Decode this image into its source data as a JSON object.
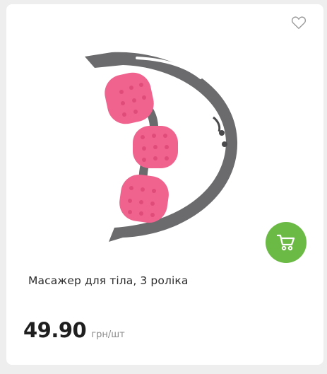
{
  "product": {
    "name": "Масажер для тіла, 3 роліка",
    "price": "49.90",
    "price_unit": "грн/шт",
    "image_icon": "roller-massager-image"
  },
  "actions": {
    "wishlist_icon": "heart-icon",
    "cart_icon": "shopping-cart-icon"
  },
  "colors": {
    "accent": "#6cba46",
    "roller": "#f0638f",
    "frame": "#6b6b6d"
  }
}
